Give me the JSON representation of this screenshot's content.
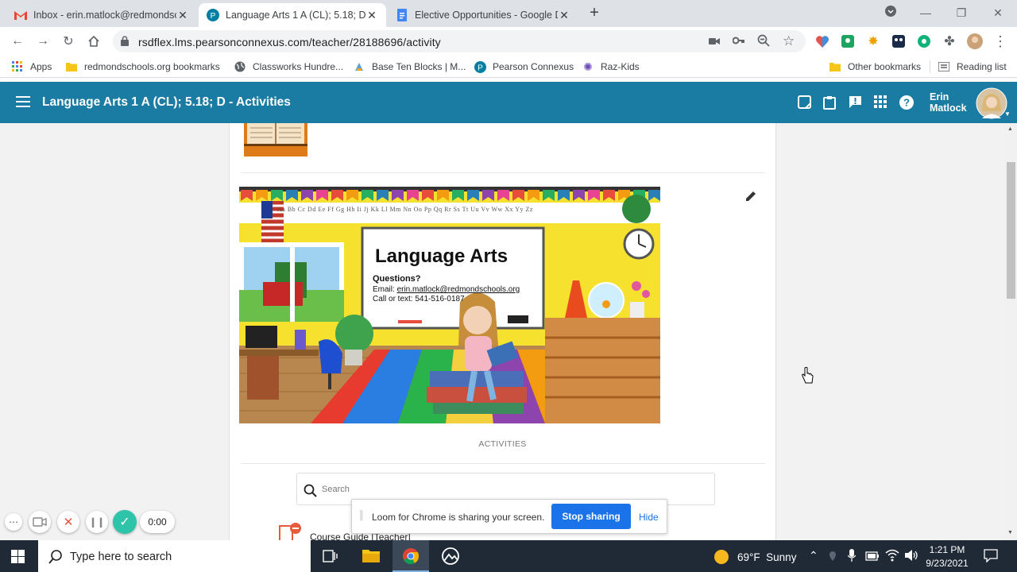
{
  "browser": {
    "tabs": [
      {
        "title": "Inbox - erin.matlock@redmondsc",
        "icon": "gmail-icon"
      },
      {
        "title": "Language Arts 1 A (CL); 5.18; D -",
        "icon": "pearson-icon"
      },
      {
        "title": "Elective Opportunities - Google D",
        "icon": "google-docs-icon"
      }
    ],
    "url": "rsdflex.lms.pearsonconnexus.com/teacher/28188696/activity",
    "bookmarks": [
      {
        "label": "Apps"
      },
      {
        "label": "redmondschools.org bookmarks"
      },
      {
        "label": "Classworks Hundre..."
      },
      {
        "label": "Base Ten Blocks | M..."
      },
      {
        "label": "Pearson Connexus"
      },
      {
        "label": "Raz-Kids"
      }
    ],
    "other_bookmarks": "Other bookmarks",
    "reading_list": "Reading list"
  },
  "app": {
    "title": "Language Arts 1 A (CL); 5.18; D - Activities",
    "user_first": "Erin",
    "user_last": "Matlock",
    "accent": "#1a7ca3"
  },
  "banner": {
    "title": "Language Arts",
    "questions": "Questions?",
    "email_prefix": "Email: ",
    "email": "erin.matlock@redmondschools.org",
    "phone": "Call or text: 541-516-0187",
    "alphabet": "Aa Bb Cc Dd Ee Ff Gg Hh Ii Jj Kk Ll Mm Nn Oo Pp Qq Rr Ss Tt Uu Vv Ww Xx Yy Zz"
  },
  "activities": {
    "heading": "ACTIVITIES",
    "search_placeholder": "Search",
    "first_item": "Course Guide [Teacher]"
  },
  "loom": {
    "message": "Loom for Chrome is sharing your screen.",
    "stop": "Stop sharing",
    "hide": "Hide",
    "timer": "0:00"
  },
  "taskbar": {
    "search_placeholder": "Type here to search",
    "weather": "69°F  Sunny",
    "time": "1:21 PM",
    "date": "9/23/2021"
  }
}
